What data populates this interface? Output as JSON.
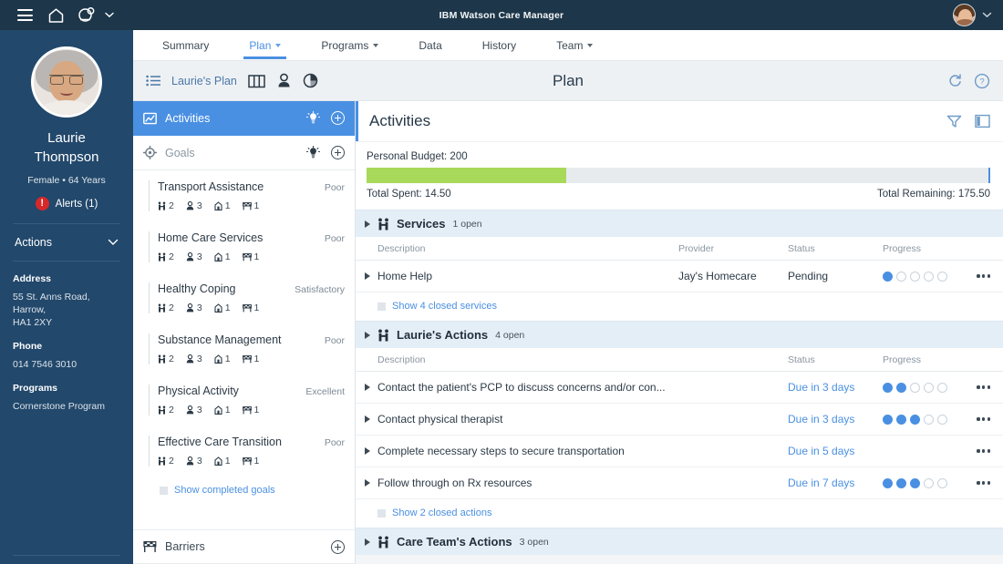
{
  "topbar": {
    "menu_icon": "hamburger-icon",
    "home_icon": "home-icon",
    "app_switch_icon": "care-manager-icon",
    "title": "IBM Watson Care Manager",
    "user_avatar": "user-avatar",
    "user_caret": "chevron-down-icon"
  },
  "client": {
    "name": "Laurie\nThompson",
    "name_line1": "Laurie",
    "name_line2": "Thompson",
    "gender": "Female",
    "separator": "•",
    "age": "64 Years",
    "meta": "Female  •  64 Years",
    "alerts_count": "!",
    "alerts_label": "Alerts (1)",
    "actions_label": "Actions",
    "address_title": "Address",
    "address_lines": "55 St. Anns Road,\nHarrow,\nHA1 2XY",
    "phone_title": "Phone",
    "phone_value": "014 7546 3010",
    "programs_title": "Programs",
    "programs_value": "Cornerstone Program"
  },
  "tabs": [
    {
      "label": "Summary",
      "active": false,
      "caret": false
    },
    {
      "label": "Plan",
      "active": true,
      "caret": true
    },
    {
      "label": "Programs",
      "active": false,
      "caret": true
    },
    {
      "label": "Data",
      "active": false,
      "caret": false
    },
    {
      "label": "History",
      "active": false,
      "caret": false
    },
    {
      "label": "Team",
      "active": false,
      "caret": true
    }
  ],
  "planbar": {
    "list_icon": "list-icon",
    "plan_name": "Laurie's Plan",
    "board_icon": "columns-view-icon",
    "person_icon": "person-view-icon",
    "pie_icon": "pie-chart-view-icon",
    "title": "Plan",
    "refresh_icon": "refresh-icon",
    "help_icon": "help-icon"
  },
  "plannav": {
    "activities": {
      "icon": "activities-icon",
      "label": "Activities",
      "insight_icon": "insight-bulb-icon",
      "add_icon": "add-icon"
    },
    "goals": {
      "icon": "goals-target-icon",
      "label": "Goals",
      "insight_icon": "insight-bulb-icon",
      "add_icon": "add-icon",
      "items": [
        {
          "name": "Transport Assistance",
          "status": "Poor",
          "counts": [
            "2",
            "3",
            "1",
            "1"
          ]
        },
        {
          "name": "Home Care Services",
          "status": "Poor",
          "counts": [
            "2",
            "3",
            "1",
            "1"
          ]
        },
        {
          "name": "Healthy Coping",
          "status": "Satisfactory",
          "counts": [
            "2",
            "3",
            "1",
            "1"
          ]
        },
        {
          "name": "Substance Management",
          "status": "Poor",
          "counts": [
            "2",
            "3",
            "1",
            "1"
          ]
        },
        {
          "name": "Physical Activity",
          "status": "Excellent",
          "counts": [
            "2",
            "3",
            "1",
            "1"
          ]
        },
        {
          "name": "Effective Care Transition",
          "status": "Poor",
          "counts": [
            "2",
            "3",
            "1",
            "1"
          ]
        }
      ],
      "show_completed": "Show completed goals"
    },
    "barriers": {
      "icon": "barrier-flag-icon",
      "label": "Barriers",
      "add_icon": "add-icon"
    }
  },
  "activities": {
    "title": "Activities",
    "filter_icon": "filter-icon",
    "panel_icon": "side-panel-icon",
    "budget": {
      "label": "Personal Budget: 200",
      "spent_label": "Total Spent: 14.50",
      "remaining_label": "Total Remaining: 175.50",
      "percent": 32
    },
    "groups": [
      {
        "icon": "people-group-icon",
        "name": "Services",
        "count": "1 open",
        "headers": {
          "description": "Description",
          "provider": "Provider",
          "status": "Status",
          "progress": "Progress"
        },
        "rows": [
          {
            "description": "Home Help",
            "provider": "Jay's Homecare",
            "status": "Pending",
            "status_link": false,
            "progress": 1,
            "progress_total": 5,
            "menu": "row-menu-icon"
          }
        ],
        "show_closed": "Show 4 closed services"
      },
      {
        "icon": "people-group-icon",
        "name": "Laurie's Actions",
        "count": "4 open",
        "headers": {
          "description": "Description",
          "status": "Status",
          "progress": "Progress"
        },
        "rows": [
          {
            "description": "Contact the patient's PCP to discuss concerns and/or con...",
            "status": "Due in 3 days",
            "status_link": true,
            "progress": 2,
            "progress_total": 5,
            "menu": "row-menu-icon"
          },
          {
            "description": "Contact physical therapist",
            "status": "Due in 3 days",
            "status_link": true,
            "progress": 3,
            "progress_total": 5,
            "menu": "row-menu-icon"
          },
          {
            "description": "Complete necessary steps to secure transportation",
            "status": "Due in 5 days",
            "status_link": true,
            "progress": null,
            "progress_total": 5,
            "menu": "row-menu-icon"
          },
          {
            "description": "Follow through on Rx resources",
            "status": "Due in 7 days",
            "status_link": true,
            "progress": 3,
            "progress_total": 5,
            "menu": "row-menu-icon"
          }
        ],
        "show_closed": "Show 2 closed actions"
      },
      {
        "icon": "people-group-icon",
        "name": "Care Team's Actions",
        "count": "3 open",
        "headers": null,
        "rows": [],
        "show_closed": null
      }
    ]
  },
  "colors": {
    "topbar_bg": "#1d3649",
    "sidebar_bg": "#22486b",
    "accent_blue": "#4a90e2",
    "group_header_bg": "#e4eef7",
    "budget_green": "#a8d95a",
    "alert_red": "#d62828"
  }
}
